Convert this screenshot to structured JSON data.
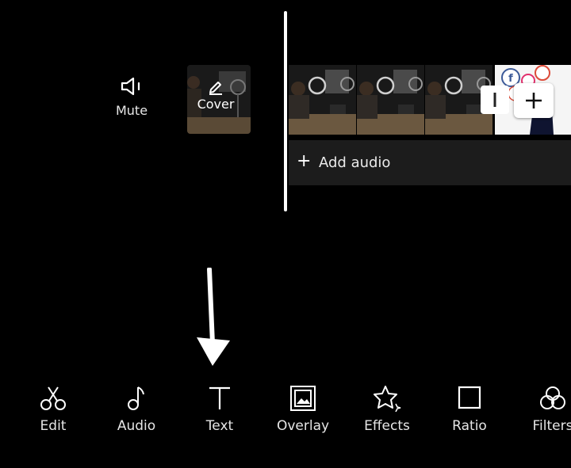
{
  "mute": {
    "icon": "speaker-icon",
    "label": "Mute"
  },
  "cover": {
    "icon": "edit-pencil-icon",
    "label": "Cover"
  },
  "timeline": {
    "add_clip_icon": "plus-icon",
    "split_icon": "split-icon"
  },
  "audio": {
    "icon": "plus-icon",
    "label": "Add audio"
  },
  "toolbar": {
    "items": [
      {
        "label": "Edit",
        "icon": "scissors-icon"
      },
      {
        "label": "Audio",
        "icon": "music-note-icon"
      },
      {
        "label": "Text",
        "icon": "text-icon"
      },
      {
        "label": "Overlay",
        "icon": "overlay-image-icon"
      },
      {
        "label": "Effects",
        "icon": "effects-star-icon"
      },
      {
        "label": "Ratio",
        "icon": "ratio-square-icon"
      },
      {
        "label": "Filters",
        "icon": "filters-circles-icon"
      }
    ]
  },
  "colors": {
    "background": "#000000",
    "track": "#1c1c1c",
    "foreground": "#ffffff"
  }
}
